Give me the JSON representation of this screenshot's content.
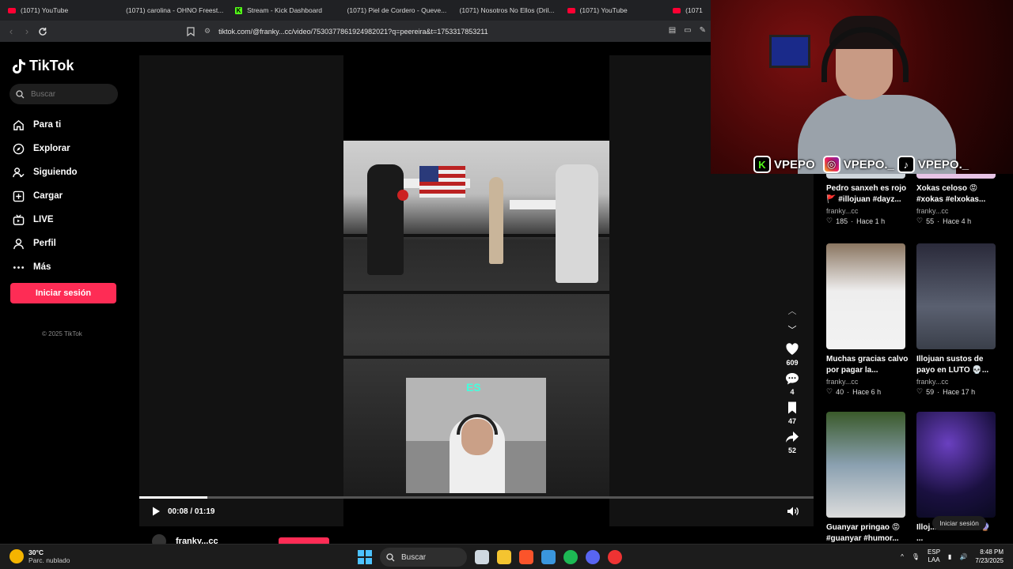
{
  "browser": {
    "tabs": [
      {
        "label": "(1071) YouTube",
        "icon": "youtube-icon"
      },
      {
        "label": "(1071) carolina - OHNO Freest...",
        "icon": "youtube-icon"
      },
      {
        "label": "Stream - Kick Dashboard",
        "icon": "kick-icon"
      },
      {
        "label": "(1071) Piel de Cordero - Queve...",
        "icon": "youtube-icon"
      },
      {
        "label": "(1071) Nosotros No Ellos (Dril...",
        "icon": "youtube-icon"
      },
      {
        "label": "(1071) YouTube",
        "icon": "youtube-icon"
      },
      {
        "label": "(1071",
        "icon": "youtube-icon"
      }
    ],
    "url": "tiktok.com/@franky...cc/video/7530377861924982021?q=peereira&t=1753317853211"
  },
  "sidebar": {
    "logo": "TikTok",
    "search_placeholder": "Buscar",
    "nav": [
      {
        "label": "Para ti",
        "icon": "home-icon"
      },
      {
        "label": "Explorar",
        "icon": "compass-icon"
      },
      {
        "label": "Siguiendo",
        "icon": "following-icon"
      },
      {
        "label": "Cargar",
        "icon": "upload-icon"
      },
      {
        "label": "LIVE",
        "icon": "live-icon"
      },
      {
        "label": "Perfil",
        "icon": "profile-icon"
      },
      {
        "label": "Más",
        "icon": "more-icon"
      }
    ],
    "login": "Iniciar sesión",
    "copyright": "© 2025 TikTok"
  },
  "player": {
    "time": "00:08 / 01:19",
    "progress": 0.101,
    "overlay_text": "ES",
    "author": "franky...cc"
  },
  "actions": {
    "likes": "609",
    "comments": "4",
    "saves": "47",
    "shares": "52"
  },
  "related": [
    {
      "title": "Pedro sanxeh es rojo 🚩 #illojuan #dayz...",
      "author": "franky...cc",
      "likes": "185",
      "time": "Hace 1 h"
    },
    {
      "title": "Xokas celoso 😡 #xokas #elxokas...",
      "author": "franky...cc",
      "likes": "55",
      "time": "Hace 4 h"
    },
    {
      "title": "Muchas gracias calvo por pagar la...",
      "author": "franky...cc",
      "likes": "40",
      "time": "Hace 6 h"
    },
    {
      "title": "Illojuan sustos de payo en LUTO 💀...",
      "author": "franky...cc",
      "likes": "59",
      "time": "Hace 17 h"
    },
    {
      "title": "Guanyar pringao 😡 #guanyar #humor...",
      "author": "",
      "likes": "",
      "time": ""
    },
    {
      "title": "Illoj... de Lamine 🔮 ...",
      "author": "",
      "likes": "",
      "time": ""
    }
  ],
  "float_login": "Iniciar sesión",
  "streamer": {
    "kick": "VPEPO",
    "instagram": "VPEPO._",
    "tiktok": "VPEPO._"
  },
  "taskbar": {
    "temp": "30°C",
    "weather": "Parc. nublado",
    "search": "Buscar",
    "lang1": "ESP",
    "lang2": "LAA",
    "time": "8:48 PM",
    "date": "7/23/2025"
  },
  "colors": {
    "accent": "#fe2c55",
    "kick": "#53fc18"
  }
}
